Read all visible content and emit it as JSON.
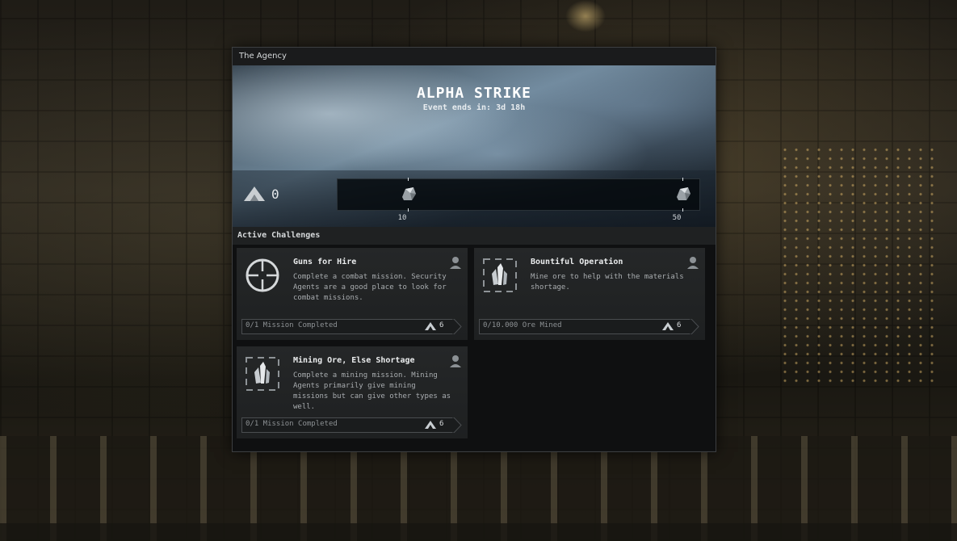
{
  "window": {
    "title": "The Agency"
  },
  "event": {
    "name": "ALPHA STRIKE",
    "ends_label": "Event ends in: 3d 18h",
    "points": "0",
    "milestones": [
      {
        "label": "10",
        "icon": "ore-crate-icon"
      },
      {
        "label": "50",
        "icon": "ore-crate-icon"
      }
    ]
  },
  "challenges": {
    "header": "Active Challenges",
    "items": [
      {
        "title": "Guns for Hire",
        "description": "Complete a combat mission. Security Agents are a good place to look for combat missions.",
        "progress": "0/1 Mission Completed",
        "reward": "6",
        "icon": "crosshair-icon"
      },
      {
        "title": "Bountiful Operation",
        "description": "Mine ore to help with the materials shortage.",
        "progress": "0/10.000 Ore Mined",
        "reward": "6",
        "icon": "ore-crystal-icon"
      },
      {
        "title": "Mining Ore, Else Shortage",
        "description": "Complete a mining mission. Mining Agents primarily give mining missions but can give other types as well.",
        "progress": "0/1 Mission Completed",
        "reward": "6",
        "icon": "ore-crystal-icon"
      }
    ]
  },
  "colors": {
    "window_bg": "#121314",
    "card_bg": "#252728",
    "accent_text": "#eaeced"
  }
}
